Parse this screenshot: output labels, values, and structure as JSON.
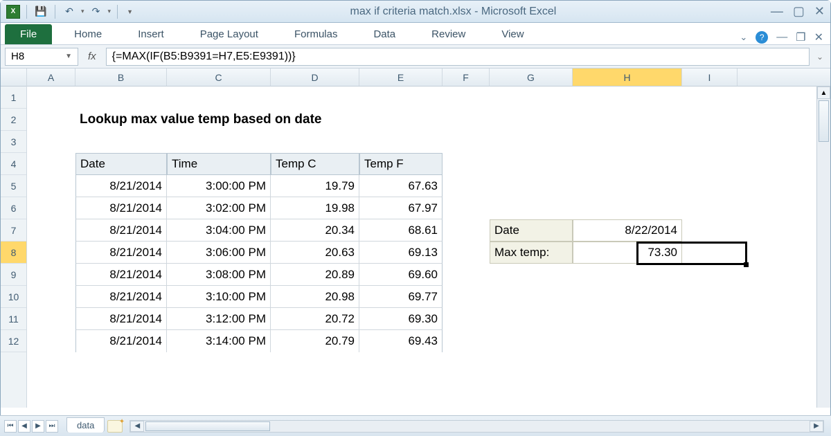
{
  "window": {
    "title": "max if criteria match.xlsx - Microsoft Excel"
  },
  "qat": {
    "save": "💾",
    "undo": "↶",
    "redo": "↷"
  },
  "tabs": {
    "file": "File",
    "home": "Home",
    "insert": "Insert",
    "page_layout": "Page Layout",
    "formulas": "Formulas",
    "data": "Data",
    "review": "Review",
    "view": "View"
  },
  "name_box": "H8",
  "formula": "{=MAX(IF(B5:B9391=H7,E5:E9391))}",
  "columns": [
    "A",
    "B",
    "C",
    "D",
    "E",
    "F",
    "G",
    "H",
    "I"
  ],
  "row_numbers": [
    1,
    2,
    3,
    4,
    5,
    6,
    7,
    8,
    9,
    10,
    11,
    12
  ],
  "heading": "Lookup max value temp based on date",
  "headers": {
    "date": "Date",
    "time": "Time",
    "tempc": "Temp C",
    "tempf": "Temp F"
  },
  "rows": [
    {
      "date": "8/21/2014",
      "time": "3:00:00 PM",
      "c": "19.79",
      "f": "67.63"
    },
    {
      "date": "8/21/2014",
      "time": "3:02:00 PM",
      "c": "19.98",
      "f": "67.97"
    },
    {
      "date": "8/21/2014",
      "time": "3:04:00 PM",
      "c": "20.34",
      "f": "68.61"
    },
    {
      "date": "8/21/2014",
      "time": "3:06:00 PM",
      "c": "20.63",
      "f": "69.13"
    },
    {
      "date": "8/21/2014",
      "time": "3:08:00 PM",
      "c": "20.89",
      "f": "69.60"
    },
    {
      "date": "8/21/2014",
      "time": "3:10:00 PM",
      "c": "20.98",
      "f": "69.77"
    },
    {
      "date": "8/21/2014",
      "time": "3:12:00 PM",
      "c": "20.72",
      "f": "69.30"
    },
    {
      "date": "8/21/2014",
      "time": "3:14:00 PM",
      "c": "20.79",
      "f": "69.43"
    }
  ],
  "lookup": {
    "date_label": "Date",
    "date_value": "8/22/2014",
    "max_label": "Max temp:",
    "max_value": "73.30"
  },
  "sheet": {
    "name": "data"
  },
  "selected": {
    "row": 8,
    "col": "H"
  }
}
